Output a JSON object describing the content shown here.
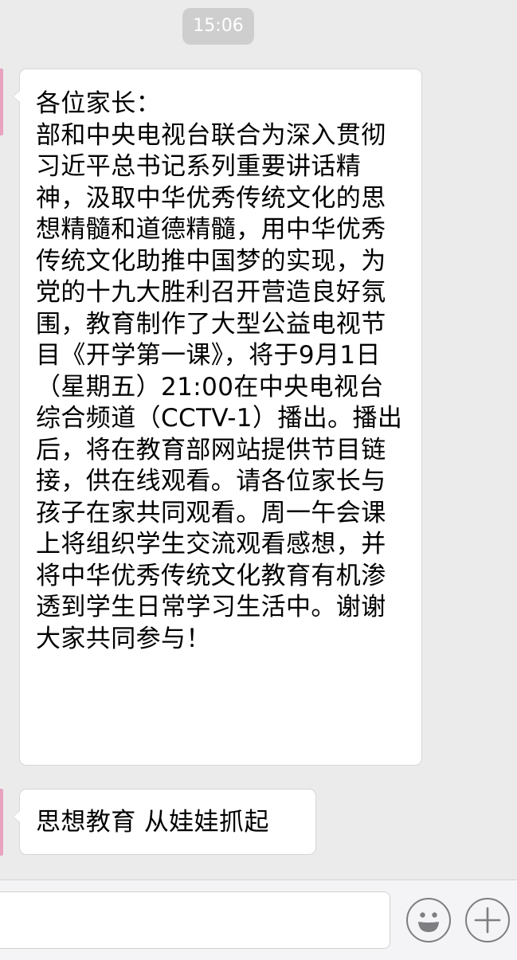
{
  "chat": {
    "timestamp": "15:06",
    "messages": [
      {
        "text": "各位家长：\n部和中央电视台联合为深入贯彻习近平总书记系列重要讲话精神，汲取中华优秀传统文化的思想精髓和道德精髓，用中华优秀传统文化助推中国梦的实现，为党的十九大胜利召开营造良好氛围，教育制作了大型公益电视节目《开学第一课》，将于9月1日（星期五）21:00在中央电视台综合频道（CCTV-1）播出。播出后，将在教育部网站提供节目链接，供在线观看。请各位家长与孩子在家共同观看。周一午会课上将组织学生交流观看感想，并将中华优秀传统文化教育有机渗透到学生日常学习生活中。谢谢大家共同参与！"
      },
      {
        "text": "思想教育 从娃娃抓起"
      }
    ]
  },
  "input_bar": {
    "value": "",
    "placeholder": "",
    "emoji_icon": "smiley-face-icon",
    "plus_icon": "plus-icon"
  },
  "colors": {
    "background": "#ebebeb",
    "bubble": "#ffffff",
    "timestamp_badge": "#cecece",
    "avatar_edge": "#e7a3c0"
  }
}
